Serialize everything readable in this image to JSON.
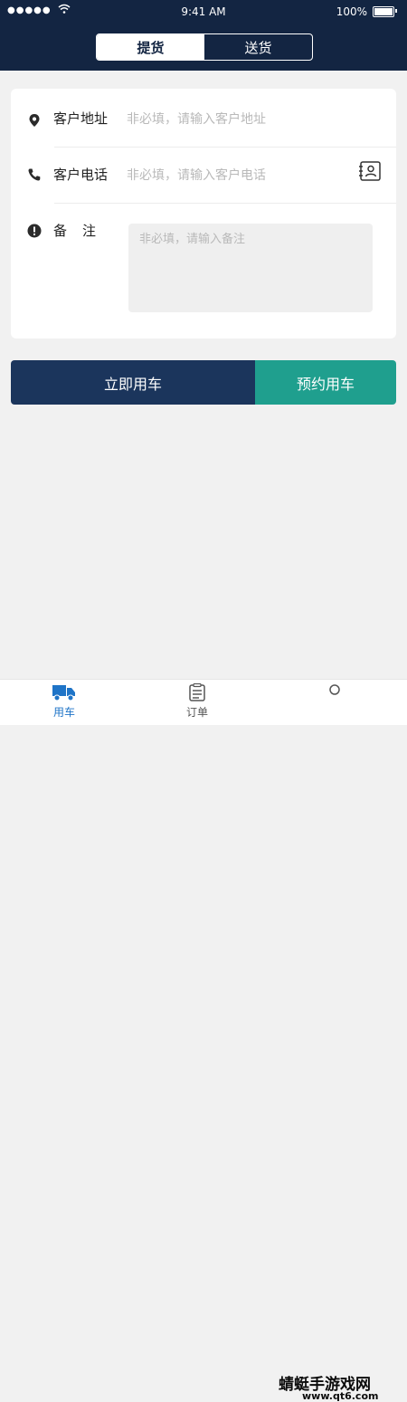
{
  "status_bar": {
    "time": "9:41 AM",
    "battery": "100%",
    "signal": "●●●●●"
  },
  "segment": {
    "pickup": "提货",
    "delivery": "送货",
    "selected": "pickup"
  },
  "form": {
    "address": {
      "label": "客户地址",
      "placeholder": "非必填，请输入客户地址"
    },
    "phone": {
      "label": "客户电话",
      "placeholder": "非必填，请输入客户电话"
    },
    "note": {
      "label": "备　注",
      "placeholder": "非必填，请输入备注"
    }
  },
  "actions": {
    "use_now": "立即用车",
    "book": "预约用车"
  },
  "tabs": [
    {
      "label": "用车",
      "icon": "truck-icon",
      "active": true
    },
    {
      "label": "订单",
      "icon": "list-icon",
      "active": false
    },
    {
      "label": "",
      "icon": "user-icon",
      "active": false
    }
  ],
  "watermark": {
    "line1": "蜻蜓手游戏网",
    "line2": "www.qt6.com"
  },
  "colors": {
    "header": "#132542",
    "primary": "#1b355c",
    "accent": "#1f9f8e",
    "tab_active": "#1f74c7"
  }
}
